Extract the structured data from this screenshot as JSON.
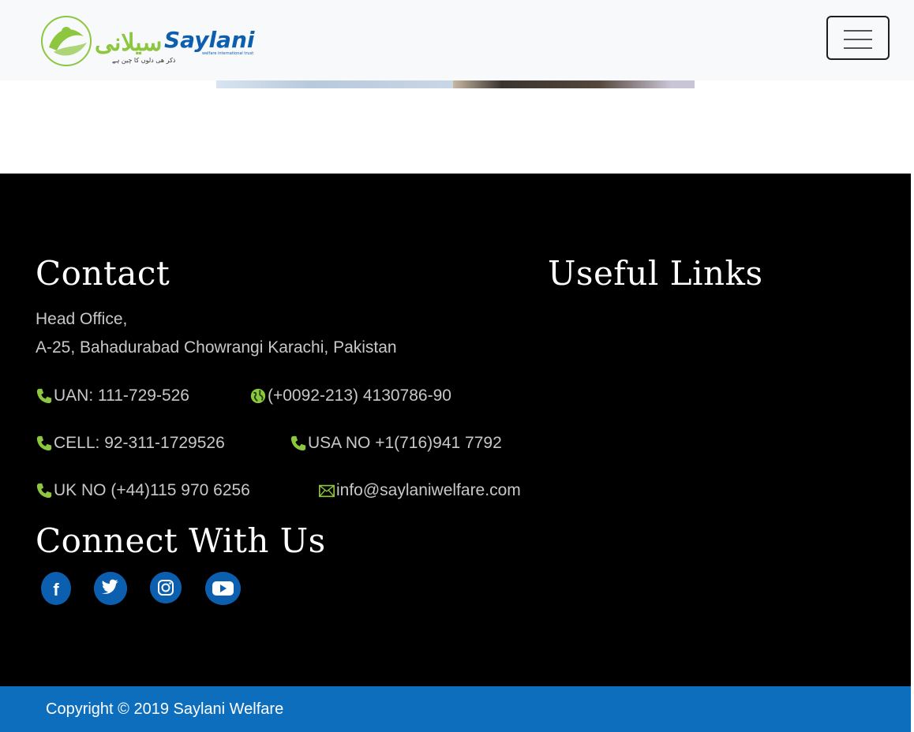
{
  "brand": {
    "logo_text": "Saylani",
    "logo_urdu": "سیلانی",
    "logo_tagline": "welfare international trust",
    "colors": {
      "green": "#8dc63f",
      "blue": "#0b5fae"
    }
  },
  "nav": {
    "menu_icon": "hamburger-icon"
  },
  "footer": {
    "contact_heading": "Contact",
    "address_line1": "Head Office,",
    "address_line2": "A-25, Bahadurabad Chowrangi Karachi, Pakistan",
    "uan": "UAN: 111-729-526",
    "intl_phone": "(+0092-213) 4130786-90",
    "cell": "CELL: 92-311-1729526",
    "usa": "USA NO +1(716)941 7792",
    "uk": "UK NO (+44)115 970 6256",
    "email": "info@saylaniwelfare.com",
    "useful_links_heading": "Useful Links",
    "connect_heading": "Connect With Us",
    "social": [
      "facebook-icon",
      "twitter-icon",
      "instagram-icon",
      "youtube-icon"
    ]
  },
  "copyright": "Copyright © 2019 Saylani Welfare"
}
